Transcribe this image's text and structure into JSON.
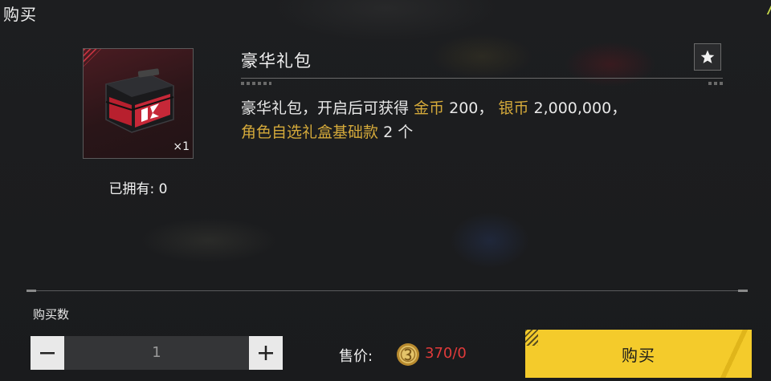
{
  "dialog": {
    "title": "购买"
  },
  "item": {
    "name": "豪华礼包",
    "quantity_label": "×1",
    "owned_text": "已拥有: 0",
    "icon": "red-black-chest"
  },
  "description": {
    "intro": "豪华礼包，开启后可获得",
    "reward1_name": "金币",
    "reward1_value": "200，",
    "reward2_name": "银币",
    "reward2_value": "2,000,000，",
    "reward3_name": "角色自选礼盒基础款",
    "reward3_value": "2 个"
  },
  "purchase": {
    "quantity_heading": "购买数",
    "quantity_value": "1",
    "price_label": "售价:",
    "price_value": "370/0",
    "buy_label": "购买"
  },
  "colors": {
    "accent_yellow": "#f4cb2b",
    "gold_text": "#d4a93a",
    "price_red": "#e03a3a"
  }
}
